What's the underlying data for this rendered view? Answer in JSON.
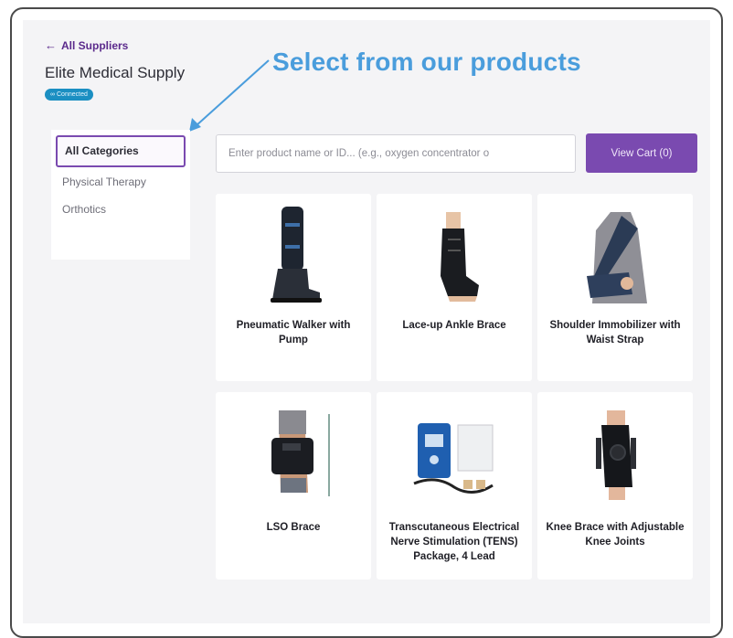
{
  "header": {
    "back_label": "All Suppliers",
    "supplier_name": "Elite Medical Supply",
    "status_badge": "Connected"
  },
  "annotation": {
    "banner_text": "Select from our products"
  },
  "sidebar": {
    "categories": [
      {
        "label": "All Categories",
        "active": true
      },
      {
        "label": "Physical Therapy",
        "active": false
      },
      {
        "label": "Orthotics",
        "active": false
      }
    ]
  },
  "search": {
    "placeholder": "Enter product name or ID... (e.g., oxygen concentrator o"
  },
  "cart": {
    "label": "View Cart (0)"
  },
  "products": [
    {
      "name": "Pneumatic Walker with Pump",
      "image_icon": "walker-boot-icon"
    },
    {
      "name": "Lace-up Ankle Brace",
      "image_icon": "ankle-brace-icon"
    },
    {
      "name": "Shoulder Immobilizer with Waist Strap",
      "image_icon": "shoulder-sling-icon"
    },
    {
      "name": "LSO Brace",
      "image_icon": "back-brace-icon"
    },
    {
      "name": "Transcutaneous Electrical Nerve Stimulation (TENS) Package, 4 Lead",
      "image_icon": "tens-unit-icon"
    },
    {
      "name": "Knee Brace with Adjustable Knee Joints",
      "image_icon": "knee-brace-icon"
    }
  ],
  "colors": {
    "accent_purple": "#7a4ab0",
    "badge_blue": "#1b8fc2",
    "annotation_blue": "#4a9ddc"
  }
}
